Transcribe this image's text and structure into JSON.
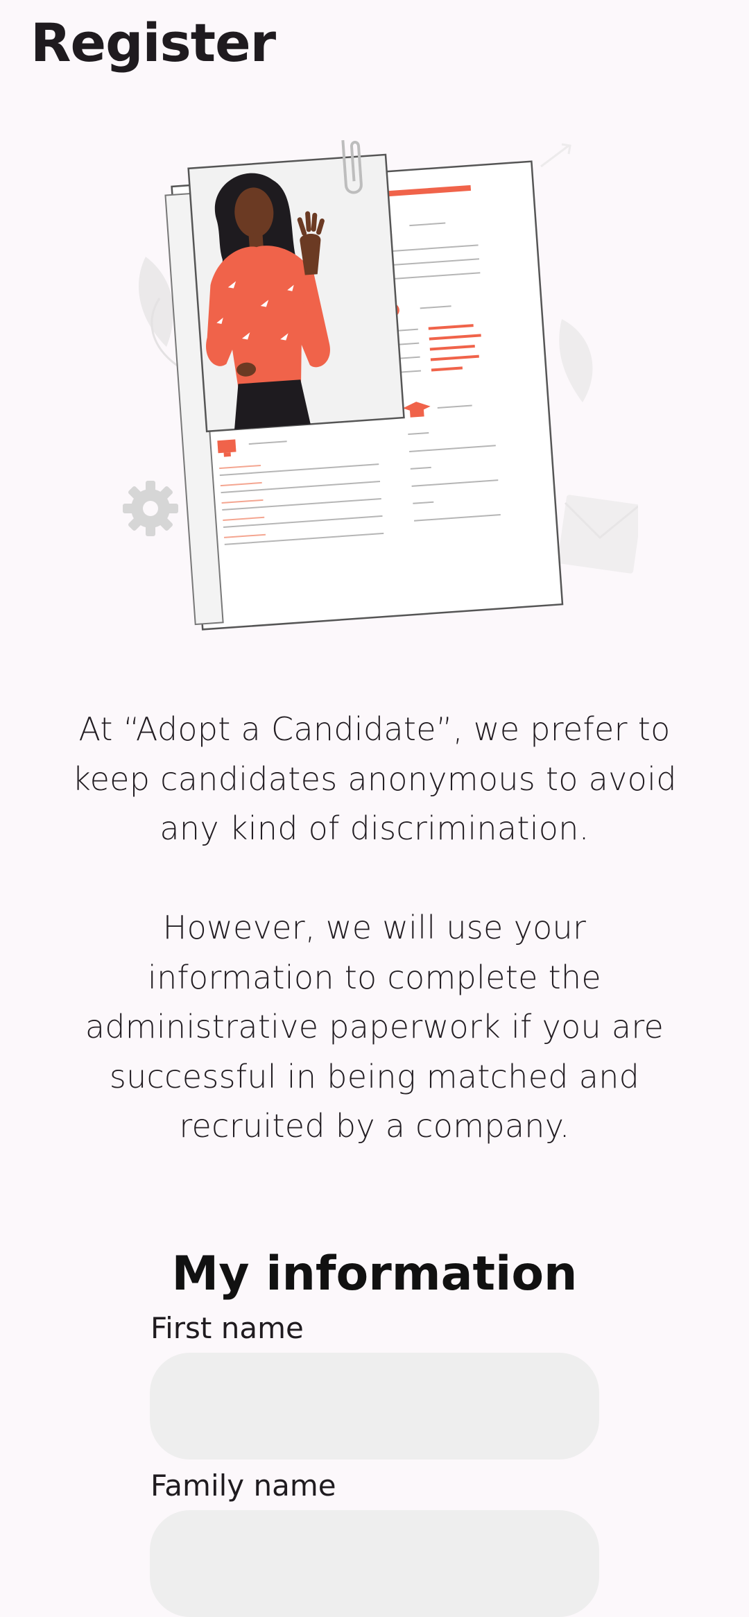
{
  "header": {
    "title": "Register"
  },
  "intro": {
    "paragraph_1": "At “Adopt a Candidate”, we prefer to keep candidates anonymous to avoid any kind of discrimination.",
    "paragraph_2": "However, we will use your information to complete the administrative paperwork if you are successful in being matched and recruited by a company."
  },
  "form": {
    "title": "My information",
    "first_name": {
      "label": "First name",
      "value": ""
    },
    "family_name": {
      "label": "Family name",
      "value": ""
    }
  },
  "illustration": {
    "name": "resume-illustration",
    "accent_color": "#f0634a"
  }
}
